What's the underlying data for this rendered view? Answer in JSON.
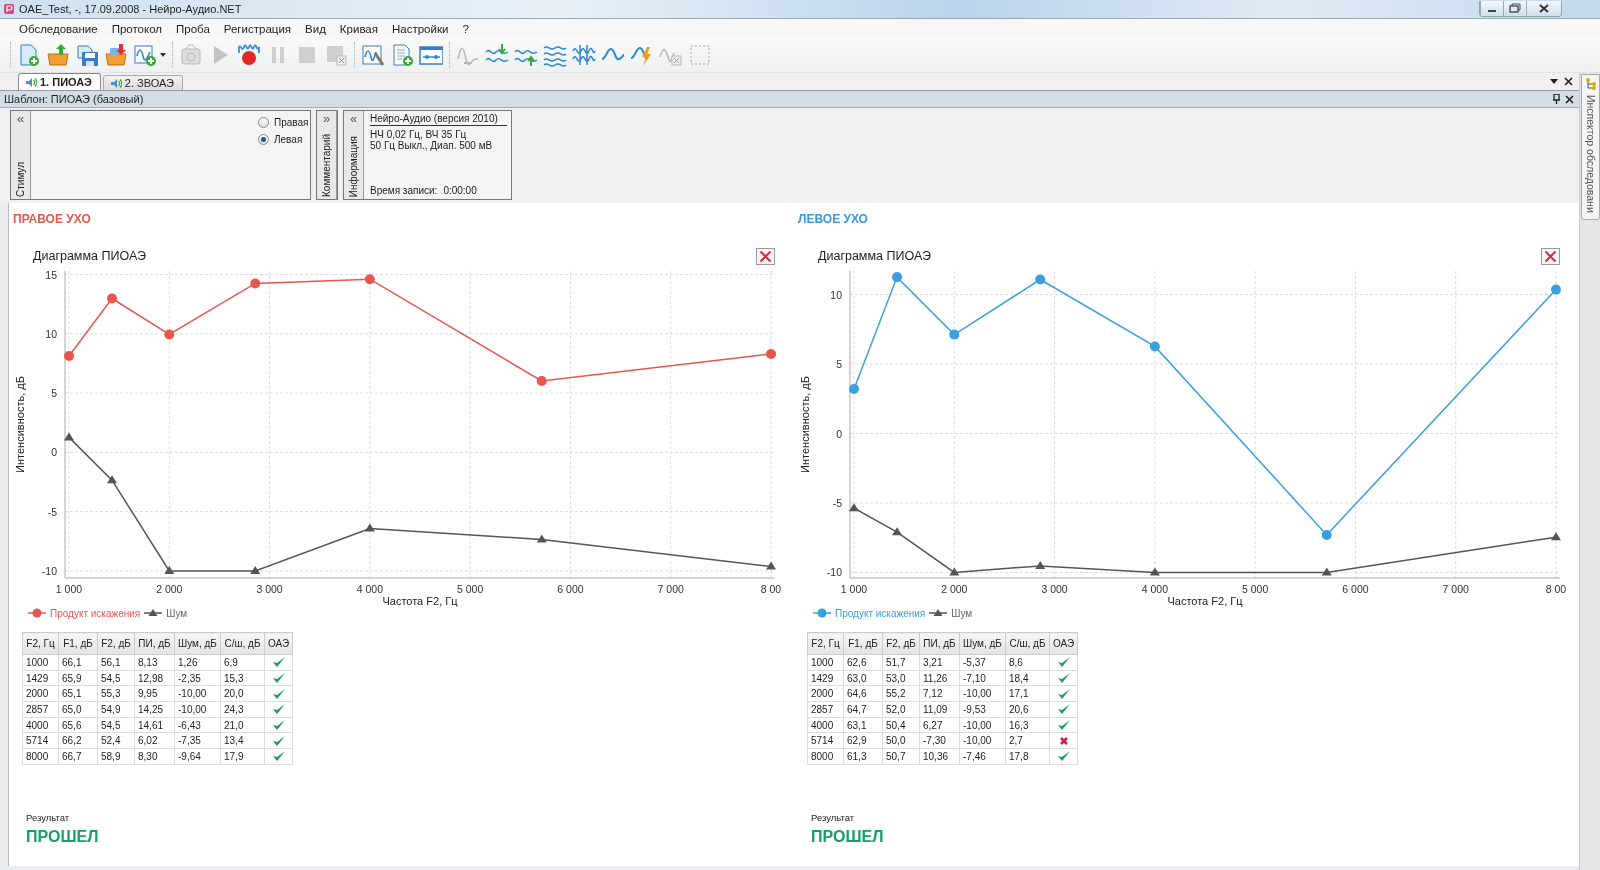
{
  "window": {
    "title": "OAE_Test, -, 17.09.2008 - Нейро-Аудио.NET"
  },
  "menu": [
    {
      "label": "Обследование"
    },
    {
      "label": "Протокол"
    },
    {
      "label": "Проба"
    },
    {
      "label": "Регистрация"
    },
    {
      "label": "Вид"
    },
    {
      "label": "Кривая"
    },
    {
      "label": "Настройки"
    },
    {
      "label": "?"
    }
  ],
  "toolbar": [
    {
      "items": [
        {
          "kind": "new-doc",
          "disabled": false
        },
        {
          "kind": "open-folder",
          "disabled": false
        },
        {
          "kind": "save",
          "disabled": false
        },
        {
          "kind": "export-folder",
          "disabled": false
        },
        {
          "kind": "add-curve",
          "disabled": false
        }
      ]
    },
    {
      "items": [
        {
          "kind": "record-device",
          "disabled": true
        },
        {
          "kind": "play",
          "disabled": true
        },
        {
          "kind": "record",
          "disabled": false
        },
        {
          "kind": "pause",
          "disabled": true
        },
        {
          "kind": "stop",
          "disabled": true
        },
        {
          "kind": "stop-delete",
          "disabled": true
        }
      ]
    },
    {
      "items": [
        {
          "kind": "curve-settings",
          "disabled": false
        },
        {
          "kind": "add-page",
          "disabled": false
        },
        {
          "kind": "marker-window",
          "disabled": false
        }
      ]
    },
    {
      "items": [
        {
          "kind": "wave-ab",
          "disabled": true
        },
        {
          "kind": "wave-down",
          "disabled": false
        },
        {
          "kind": "wave-up",
          "disabled": false
        },
        {
          "kind": "wave-stack",
          "disabled": false
        },
        {
          "kind": "wave-lines",
          "disabled": false
        },
        {
          "kind": "wave",
          "disabled": false
        },
        {
          "kind": "wave-flash",
          "disabled": false
        },
        {
          "kind": "wave-delete",
          "disabled": true
        },
        {
          "kind": "select-area",
          "disabled": true
        }
      ]
    }
  ],
  "tabs": [
    {
      "label": "1. ПИОАЭ",
      "selected": true
    },
    {
      "label": "2. ЗВОАЭ",
      "selected": false
    }
  ],
  "template": {
    "label": "Шаблон: ПИОАЭ (базовый)"
  },
  "stimulus_panel": {
    "collapse": "«",
    "title": "Стимул",
    "options": [
      {
        "label": "Правая",
        "selected": false
      },
      {
        "label": "Левая",
        "selected": true
      }
    ]
  },
  "comment_panel": {
    "expand": "»",
    "title": "Комментарий"
  },
  "info_panel": {
    "collapse": "«",
    "title": "Информация",
    "device": "Нейро-Аудио (версия 2010)",
    "lines": [
      "НЧ  0,02 Гц, ВЧ  35 Гц",
      "50 Гц  Выкл., Диап. 500 мВ"
    ],
    "record_time_label": "Время записи:",
    "record_time": "0:00:00"
  },
  "ears": [
    {
      "title": "ПРАВОЕ УХО",
      "color": "#e05a4e",
      "chart_data": {
        "type": "line",
        "title": "Диаграмма ПИОАЭ",
        "xlabel": "Частота F2, Гц",
        "ylabel": "Интенсивность, дБ",
        "x": [
          1000,
          1429,
          2000,
          2857,
          4000,
          5714,
          8000
        ],
        "series": [
          {
            "name": "Продукт искажения",
            "color": "#e8554e",
            "marker": "circle",
            "values": [
              8.13,
              12.98,
              9.95,
              14.25,
              14.61,
              6.02,
              8.3
            ]
          },
          {
            "name": "Шум",
            "color": "#555555",
            "marker": "triangle",
            "values": [
              1.26,
              -2.35,
              -10,
              -10,
              -6.43,
              -7.35,
              -9.64
            ]
          }
        ],
        "grid": true,
        "xlim": [
          960,
          8040
        ],
        "ylim": [
          -10.6,
          15.3
        ],
        "xticks": [
          {
            "value": 1000,
            "label": "1 000"
          },
          {
            "value": 2000,
            "label": "2 000"
          },
          {
            "value": 3000,
            "label": "3 000"
          },
          {
            "value": 4000,
            "label": "4 000"
          },
          {
            "value": 5000,
            "label": "5 000"
          },
          {
            "value": 6000,
            "label": "6 000"
          },
          {
            "value": 7000,
            "label": "7 000"
          },
          {
            "value": 8000,
            "label": "8 00"
          }
        ],
        "yticks": [
          -10,
          -5,
          0,
          5,
          10,
          15
        ]
      },
      "table": {
        "columns": [
          "F2, Гц",
          "F1, дБ",
          "F2, дБ",
          "ПИ, дБ",
          "Шум, дБ",
          "С/ш, дБ",
          "ОАЭ"
        ],
        "rows": [
          {
            "cells": [
              "1000",
              "66,1",
              "56,1",
              "8,13",
              "1,26",
              "6,9"
            ],
            "pass": true
          },
          {
            "cells": [
              "1429",
              "65,9",
              "54,5",
              "12,98",
              "-2,35",
              "15,3"
            ],
            "pass": true
          },
          {
            "cells": [
              "2000",
              "65,1",
              "55,3",
              "9,95",
              "-10,00",
              "20,0"
            ],
            "pass": true
          },
          {
            "cells": [
              "2857",
              "65,0",
              "54,9",
              "14,25",
              "-10,00",
              "24,3"
            ],
            "pass": true
          },
          {
            "cells": [
              "4000",
              "65,6",
              "54,5",
              "14,61",
              "-6,43",
              "21,0"
            ],
            "pass": true
          },
          {
            "cells": [
              "5714",
              "66,2",
              "52,4",
              "6,02",
              "-7,35",
              "13,4"
            ],
            "pass": true
          },
          {
            "cells": [
              "8000",
              "66,7",
              "58,9",
              "8,30",
              "-9,64",
              "17,9"
            ],
            "pass": true
          }
        ]
      },
      "result_label": "Результат",
      "result": "ПРОШЕЛ"
    },
    {
      "title": "ЛЕВОЕ УХО",
      "color": "#3a9ad9",
      "chart_data": {
        "type": "line",
        "title": "Диаграмма ПИОАЭ",
        "xlabel": "Частота F2, Гц",
        "ylabel": "Интенсивность, дБ",
        "x": [
          1000,
          1429,
          2000,
          2857,
          4000,
          5714,
          8000
        ],
        "series": [
          {
            "name": "Продукт искажения",
            "color": "#3aa0dd",
            "marker": "circle",
            "values": [
              3.21,
              11.26,
              7.12,
              11.09,
              6.27,
              -7.3,
              10.36
            ]
          },
          {
            "name": "Шум",
            "color": "#555555",
            "marker": "triangle",
            "values": [
              -5.37,
              -7.1,
              -10,
              -9.53,
              -10,
              -10,
              -7.46
            ]
          }
        ],
        "grid": true,
        "xlim": [
          960,
          8040
        ],
        "ylim": [
          -10.4,
          11.7
        ],
        "xticks": [
          {
            "value": 1000,
            "label": "1 000"
          },
          {
            "value": 2000,
            "label": "2 000"
          },
          {
            "value": 3000,
            "label": "3 000"
          },
          {
            "value": 4000,
            "label": "4 000"
          },
          {
            "value": 5000,
            "label": "5 000"
          },
          {
            "value": 6000,
            "label": "6 000"
          },
          {
            "value": 7000,
            "label": "7 000"
          },
          {
            "value": 8000,
            "label": "8 00"
          }
        ],
        "yticks": [
          -10,
          -5,
          0,
          5,
          10
        ]
      },
      "table": {
        "columns": [
          "F2, Гц",
          "F1, дБ",
          "F2, дБ",
          "ПИ, дБ",
          "Шум, дБ",
          "С/ш, дБ",
          "ОАЭ"
        ],
        "rows": [
          {
            "cells": [
              "1000",
              "62,6",
              "51,7",
              "3,21",
              "-5,37",
              "8,6"
            ],
            "pass": true
          },
          {
            "cells": [
              "1429",
              "63,0",
              "53,0",
              "11,26",
              "-7,10",
              "18,4"
            ],
            "pass": true
          },
          {
            "cells": [
              "2000",
              "64,6",
              "55,2",
              "7,12",
              "-10,00",
              "17,1"
            ],
            "pass": true
          },
          {
            "cells": [
              "2857",
              "64,7",
              "52,0",
              "11,09",
              "-9,53",
              "20,6"
            ],
            "pass": true
          },
          {
            "cells": [
              "4000",
              "63,1",
              "50,4",
              "6,27",
              "-10,00",
              "16,3"
            ],
            "pass": true
          },
          {
            "cells": [
              "5714",
              "62,9",
              "50,0",
              "-7,30",
              "-10,00",
              "2,7"
            ],
            "pass": false
          },
          {
            "cells": [
              "8000",
              "61,3",
              "50,7",
              "10,36",
              "-7,46",
              "17,8"
            ],
            "pass": true
          }
        ]
      },
      "result_label": "Результат",
      "result": "ПРОШЕЛ"
    }
  ],
  "sidebar": {
    "label": "Инспектор обследовани"
  }
}
